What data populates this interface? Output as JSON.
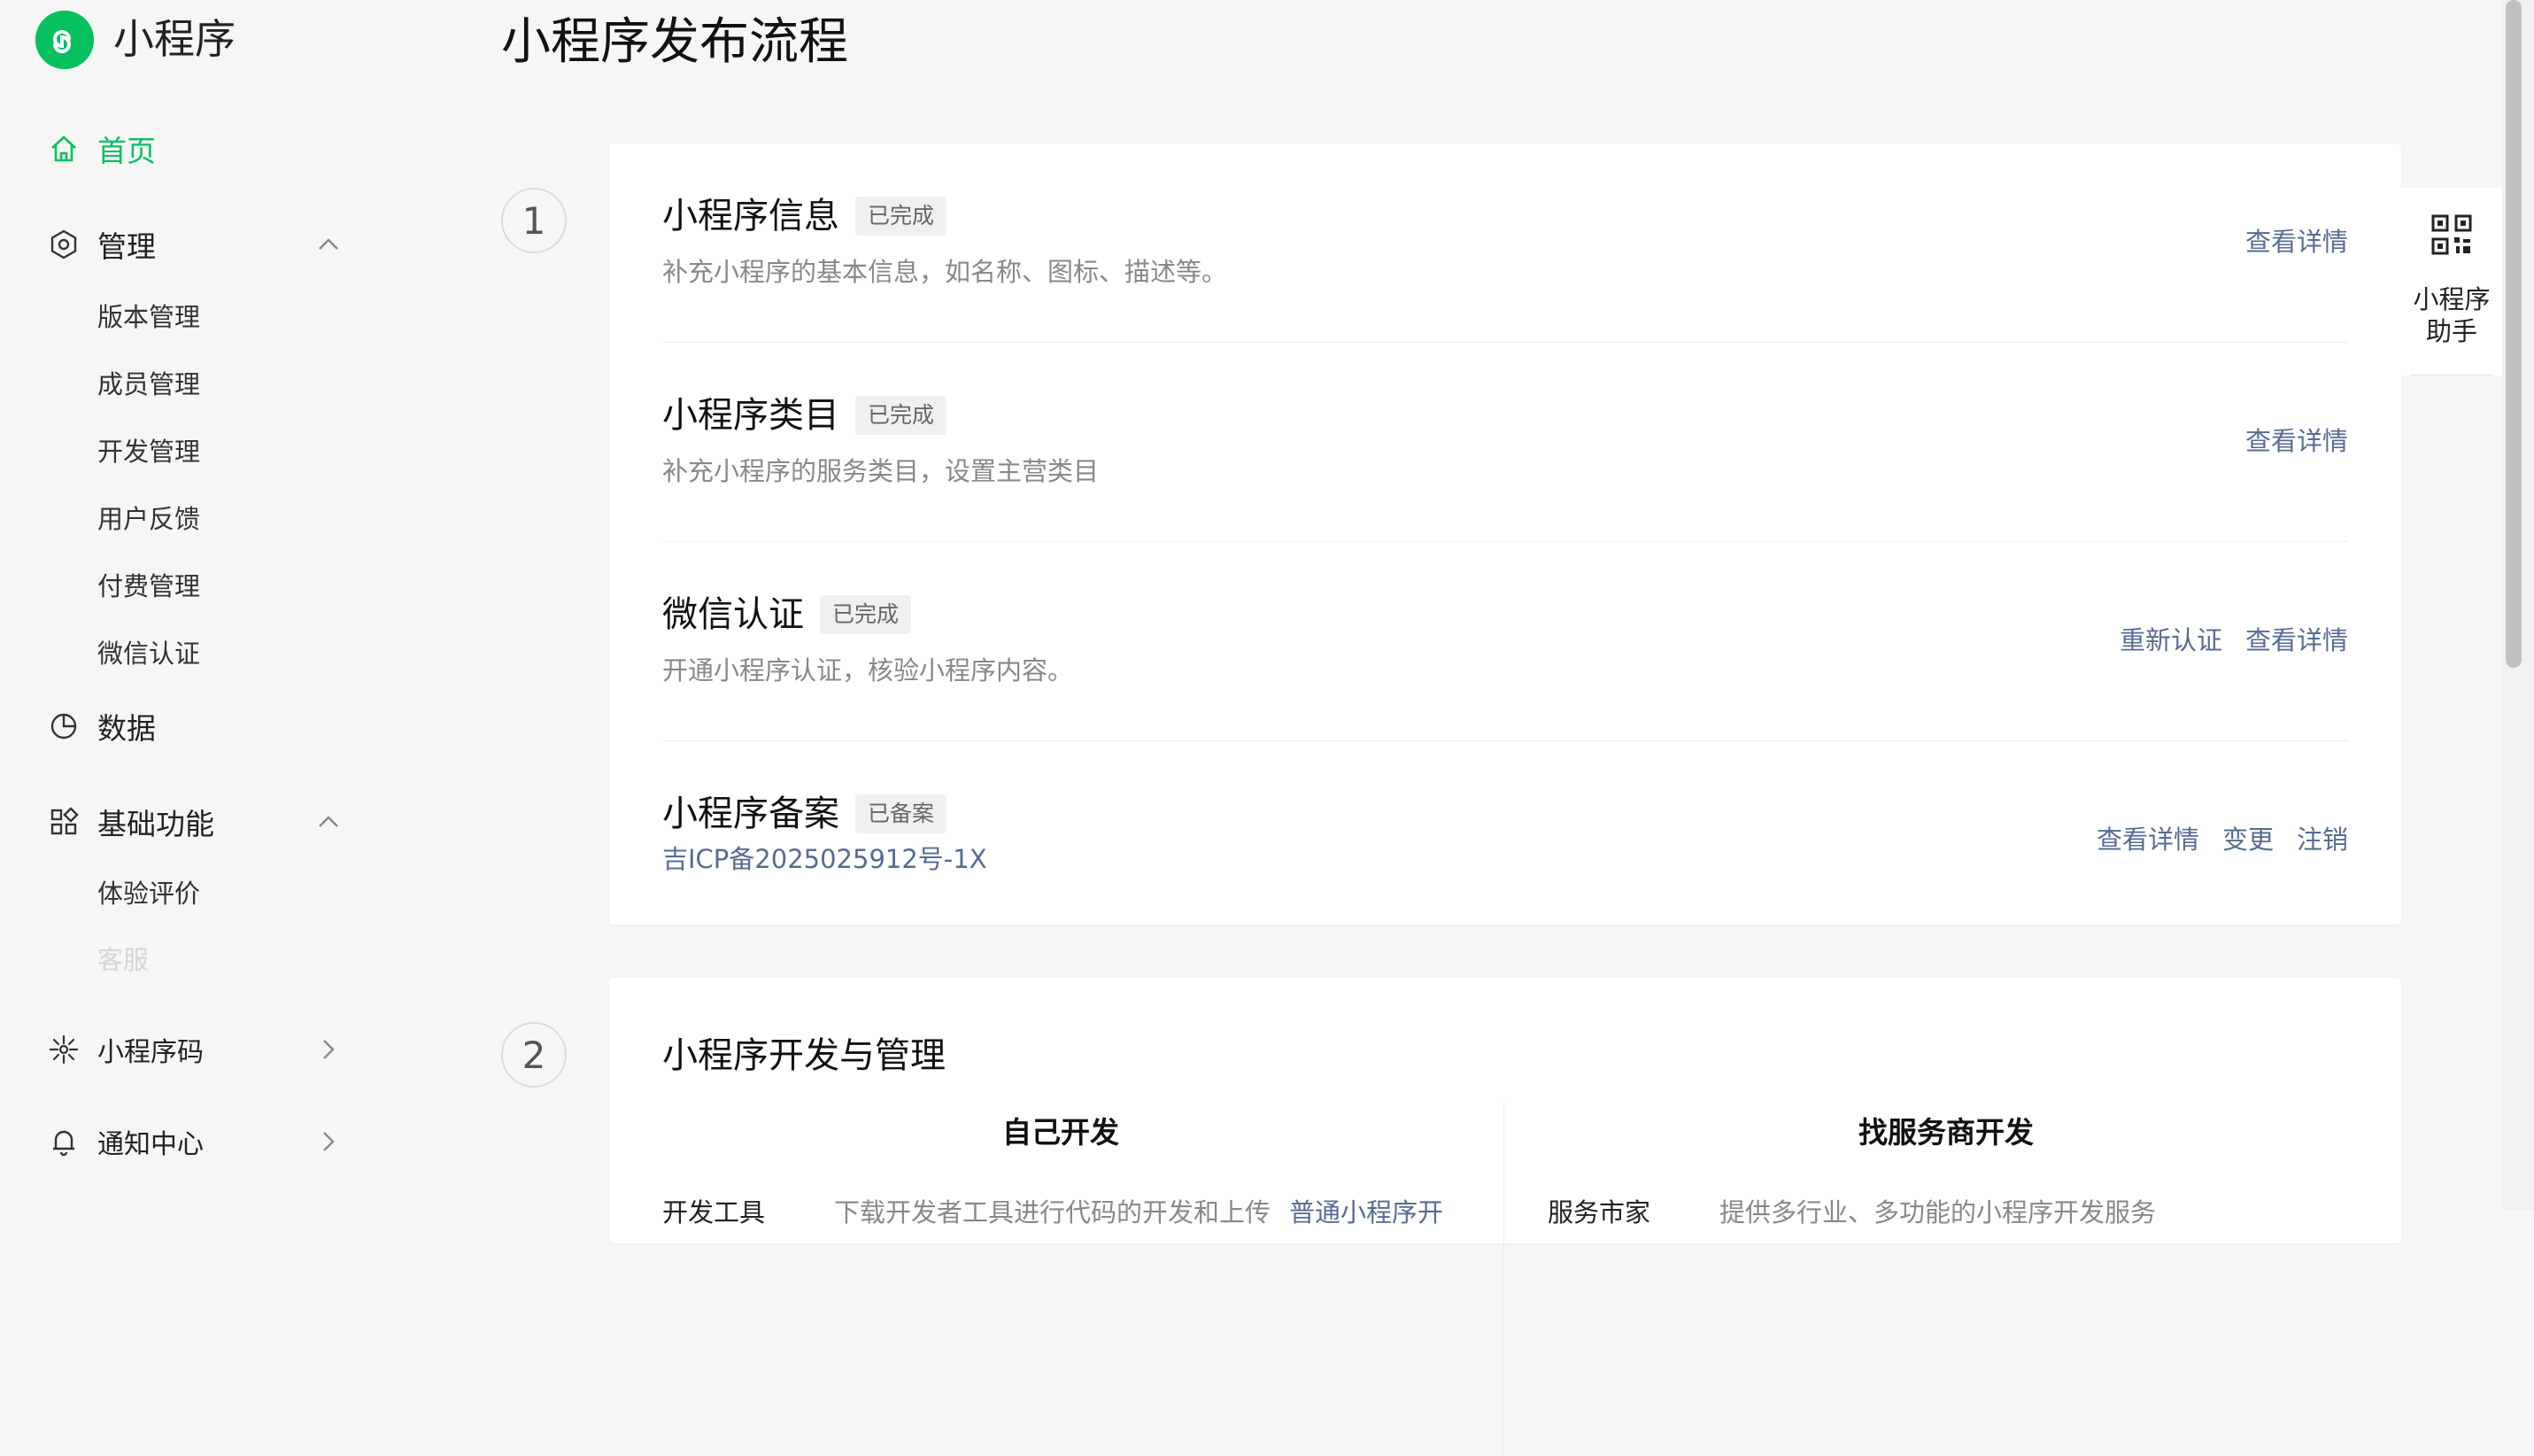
{
  "app": {
    "logo_icon": "miniprogram-logo-icon",
    "brand_color": "#07c160",
    "name": "小程序"
  },
  "sidebar": {
    "items": [
      {
        "label": "首页",
        "icon": "home-icon",
        "active": true
      },
      {
        "label": "管理",
        "icon": "hexagon-settings-icon",
        "expanded": true,
        "children": [
          "版本管理",
          "成员管理",
          "开发管理",
          "用户反馈",
          "付费管理",
          "微信认证"
        ]
      },
      {
        "label": "数据",
        "icon": "pie-chart-icon"
      },
      {
        "label": "基础功能",
        "icon": "grid-apps-icon",
        "expanded": true,
        "children": [
          "体验评价",
          "客服"
        ]
      },
      {
        "label": "小程序码",
        "icon": "sparkle-icon",
        "collapsed": true
      },
      {
        "label": "通知中心",
        "icon": "bell-icon",
        "collapsed": true
      }
    ]
  },
  "main": {
    "title": "小程序发布流程",
    "steps": [
      {
        "number": "1",
        "rows": [
          {
            "title": "小程序信息",
            "badge": "已完成",
            "desc": "补充小程序的基本信息，如名称、图标、描述等。",
            "actions": [
              "查看详情"
            ]
          },
          {
            "title": "小程序类目",
            "badge": "已完成",
            "desc": "补充小程序的服务类目，设置主营类目",
            "actions": [
              "查看详情"
            ]
          },
          {
            "title": "微信认证",
            "badge": "已完成",
            "desc": "开通小程序认证，核验小程序内容。",
            "actions": [
              "重新认证",
              "查看详情"
            ]
          },
          {
            "title": "小程序备案",
            "badge": "已备案",
            "desc": "吉ICP备2025025912号-1X",
            "actions": [
              "查看详情",
              "变更",
              "注销"
            ]
          }
        ]
      },
      {
        "number": "2",
        "title": "小程序开发与管理",
        "columns": [
          {
            "title": "自己开发",
            "partial_label": "开发工具",
            "partial_desc": "下载开发者工具进行代码的开发和上传",
            "partial_link": "普通小程序开"
          },
          {
            "title": "找服务商开发",
            "partial_label": "服务市家",
            "partial_desc": "提供多行业、多功能的小程序开发服务"
          }
        ]
      }
    ]
  },
  "helper": {
    "icon": "qr-code-icon",
    "label_line1": "小程序",
    "label_line2": "助手"
  },
  "colors": {
    "link": "#576b95",
    "muted_text": "#888888",
    "badge_bg": "#f0f0f0"
  }
}
